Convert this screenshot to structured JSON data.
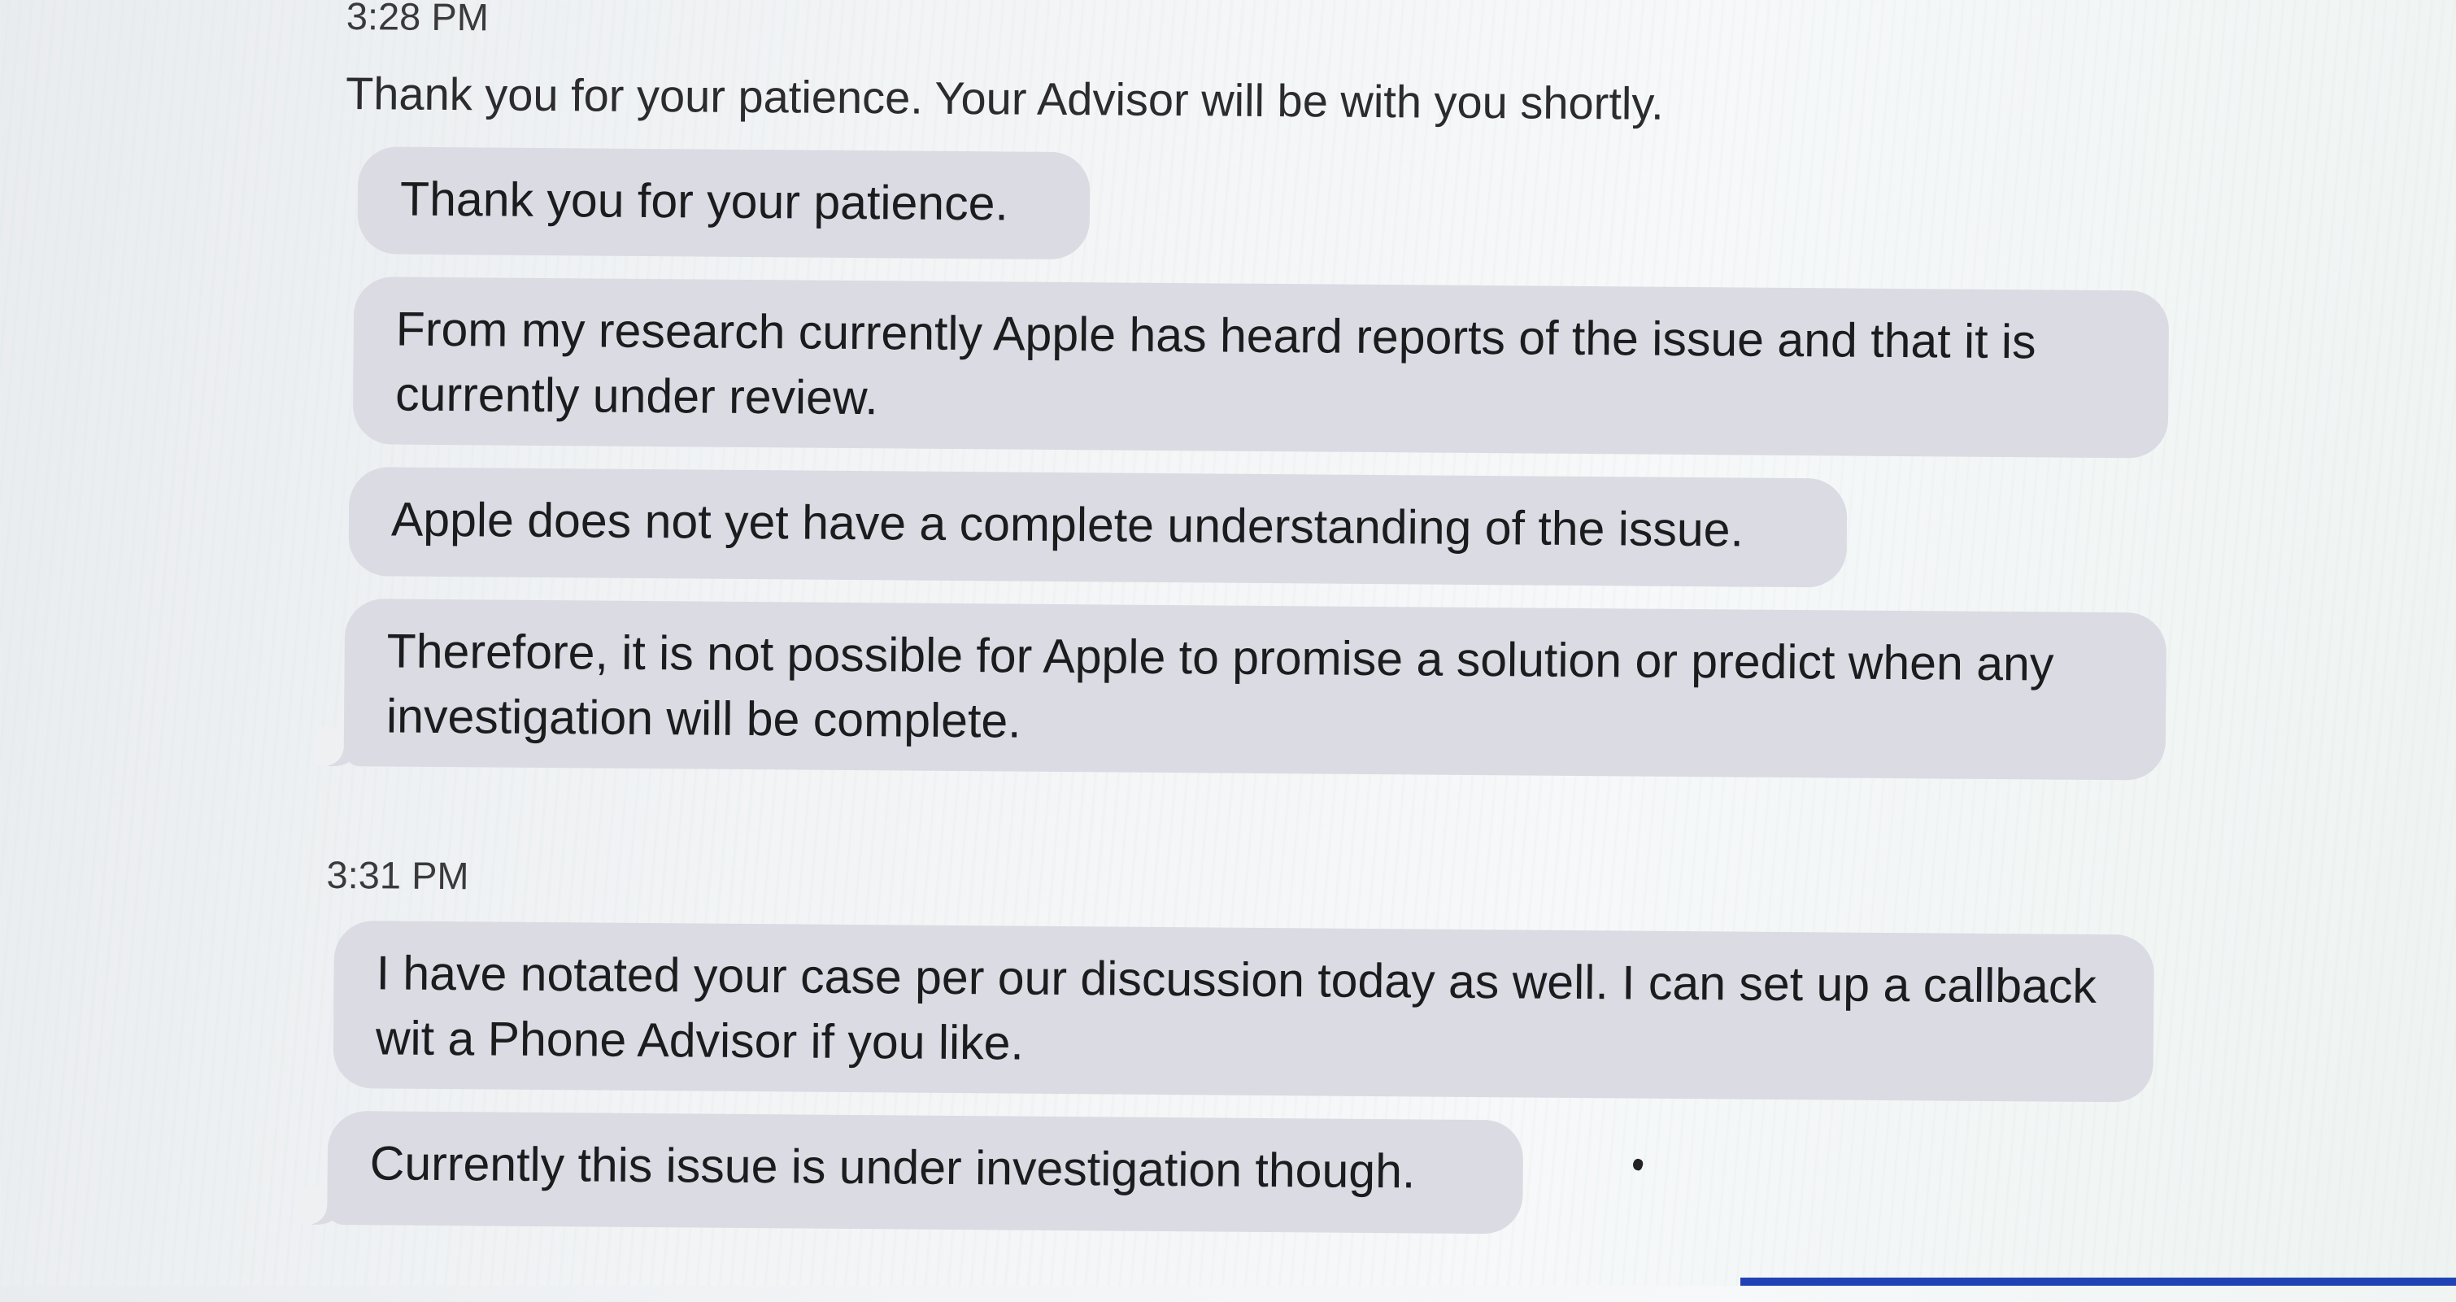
{
  "conversation": {
    "groups": [
      {
        "timestamp": "3:28 PM",
        "system_message": "Thank you for your patience. Your Advisor will be with you shortly.",
        "messages": [
          "Thank you for your patience.",
          "From my research currently Apple has heard reports of the issue and that it is currently under review.",
          "Apple does not yet have a complete understanding of the issue.",
          "Therefore, it is not possible for Apple to promise a solution or predict when any investigation will be complete."
        ]
      },
      {
        "timestamp": "3:31 PM",
        "messages": [
          "I have notated your case per our discussion today as well. I can set up a callback wit a Phone Advisor if you like.",
          "Currently this issue is under investigation though."
        ]
      }
    ]
  },
  "colors": {
    "incoming_bubble": "#dadbe3",
    "background": "#f2f4f6",
    "text": "#1c1c1e"
  }
}
